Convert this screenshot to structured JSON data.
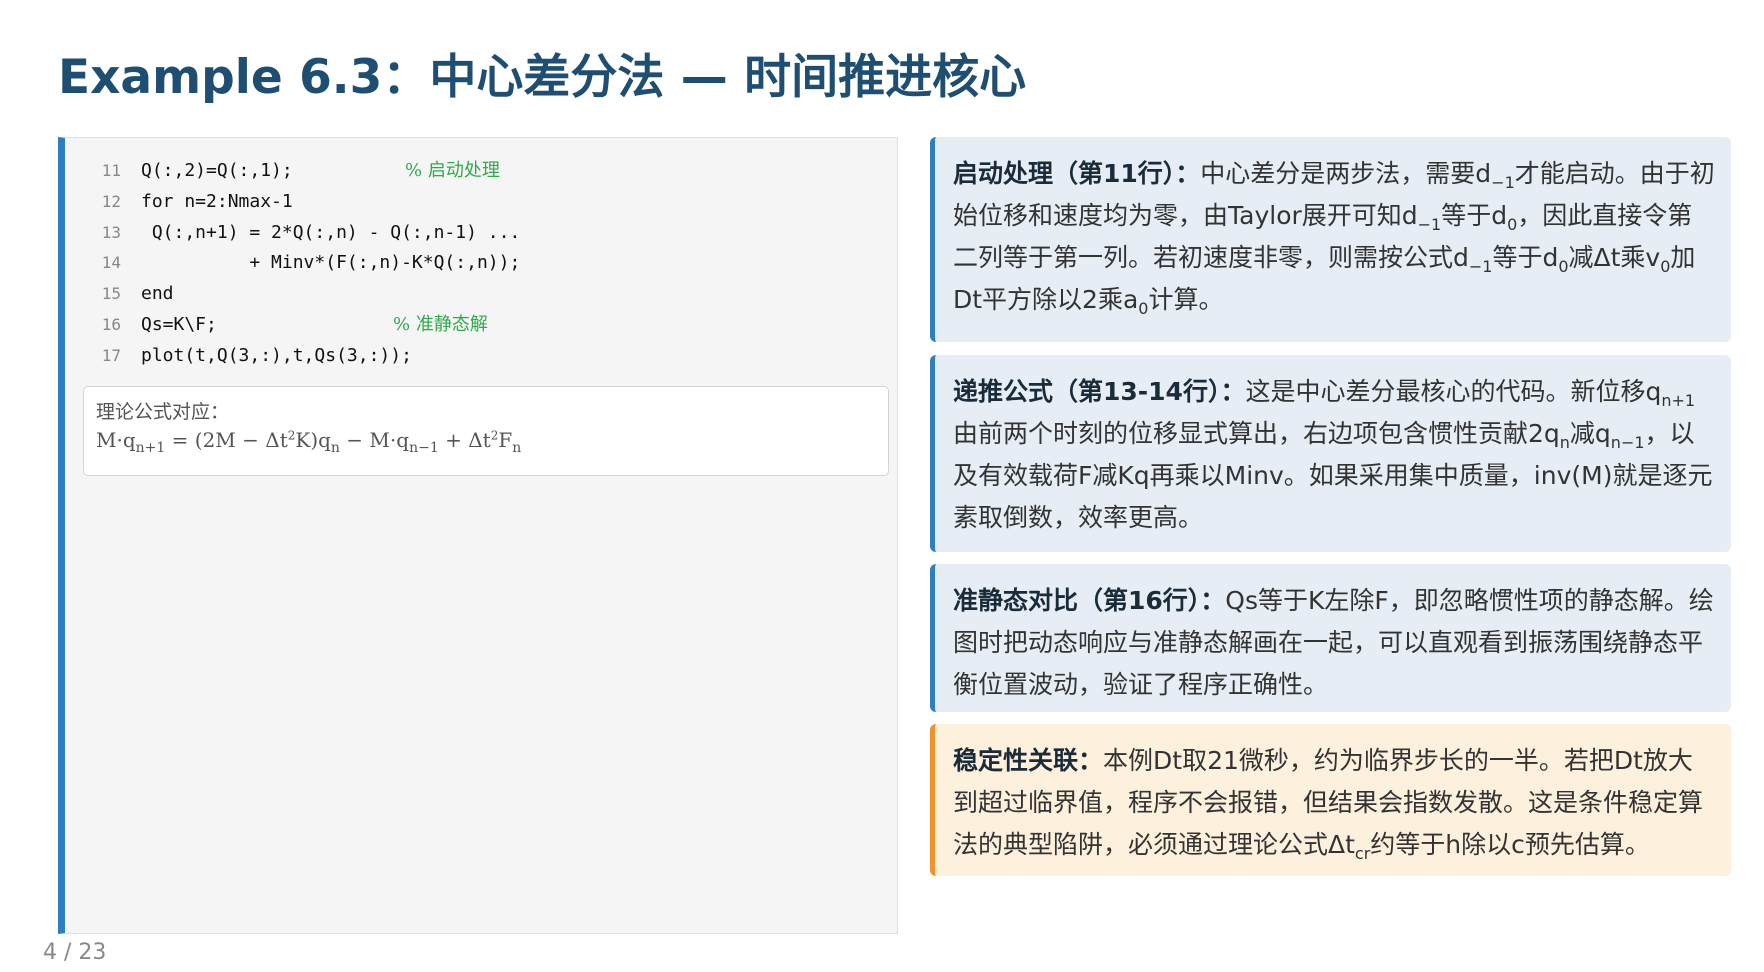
{
  "title": "Example 6.3：中心差分法 — 时间推进核心",
  "code_lines": [
    {
      "num": "11",
      "code": "Q(:,2)=Q(:,1);",
      "comment": "% 启动处理"
    },
    {
      "num": "12",
      "code": "for n=2:Nmax-1",
      "comment": ""
    },
    {
      "num": "13",
      "code": " Q(:,n+1) = 2*Q(:,n) - Q(:,n-1) ...",
      "comment": ""
    },
    {
      "num": "14",
      "code": "          + Minv*(F(:,n)-K*Q(:,n));",
      "comment": ""
    },
    {
      "num": "15",
      "code": "end",
      "comment": ""
    },
    {
      "num": "16",
      "code": "Qs=K\\F;",
      "comment": "% 准静态解"
    },
    {
      "num": "17",
      "code": "plot(t,Q(3,:),t,Qs(3,:));",
      "comment": ""
    }
  ],
  "formula": {
    "label": "理论公式对应：",
    "text": "M·qn+1 = (2M − Δt²K)qn − M·qn−1 + Δt²Fn"
  },
  "cards": [
    {
      "heading": "启动处理（第11行）：",
      "text": "中心差分是两步法，需要d−1才能启动。由于初始位移和速度均为零，由Taylor展开可知d−1等于d0，因此直接令第二列等于第一列。若初速度非零，则需按公式d−1等于d0减Δt乘v0加Dt平方除以2乘a0计算。"
    },
    {
      "heading": "递推公式（第13-14行）：",
      "text": "这是中心差分最核心的代码。新位移qn+1由前两个时刻的位移显式算出，右边项包含惯性贡献2qn减qn−1，以及有效载荷F减Kq再乘以Minv。如果采用集中质量，inv(M)就是逐元素取倒数，效率更高。"
    },
    {
      "heading": "准静态对比（第16行）：",
      "text": "Qs等于K左除F，即忽略惯性项的静态解。绘图时把动态响应与准静态解画在一起，可以直观看到振荡围绕静态平衡位置波动，验证了程序正确性。"
    },
    {
      "heading": "稳定性关联：",
      "text": "本例Dt取21微秒，约为临界步长的一半。若把Dt放大到超过临界值，程序不会报错，但结果会指数发散。这是条件稳定算法的典型陷阱，必须通过理论公式Δtcr约等于h除以c预先估算。"
    }
  ],
  "colors": {
    "title": "#1f4e73",
    "accent_blue": "#2f7ebf",
    "accent_orange": "#f0932b",
    "comment_green": "#2eaa4d",
    "card_blue_bg": "#e6edf4",
    "card_orange_bg": "#fdf0dd"
  },
  "page_indicator": "4 / 23"
}
